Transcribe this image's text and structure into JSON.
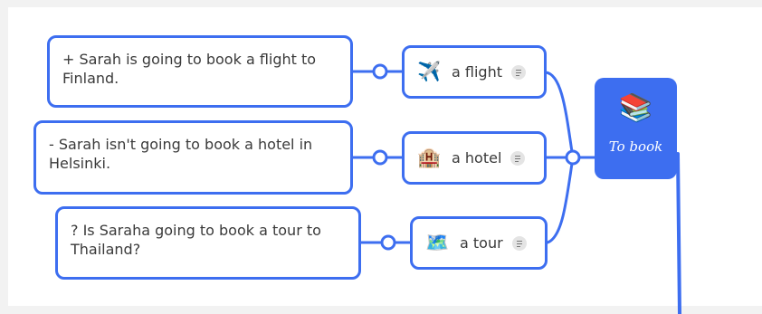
{
  "root": {
    "title": "To book",
    "icon": "books-icon",
    "emoji": "📚"
  },
  "branches": [
    {
      "label": "a flight",
      "icon": "airplane-icon",
      "emoji": "✈️",
      "note": "+ Sarah is going to book a flight to Finland."
    },
    {
      "label": "a hotel",
      "icon": "hotel-icon",
      "emoji": "🏨",
      "note": "- Sarah isn't going to book a hotel in Helsinki."
    },
    {
      "label": "a tour",
      "icon": "map-icon",
      "emoji": "🗺️",
      "note": "? Is Saraha going to book a tour to Thailand?"
    }
  ],
  "colors": {
    "accent": "#3d6ef0",
    "text": "#3a3a3a",
    "background": "#ffffff",
    "frame": "#f2f2f2"
  }
}
